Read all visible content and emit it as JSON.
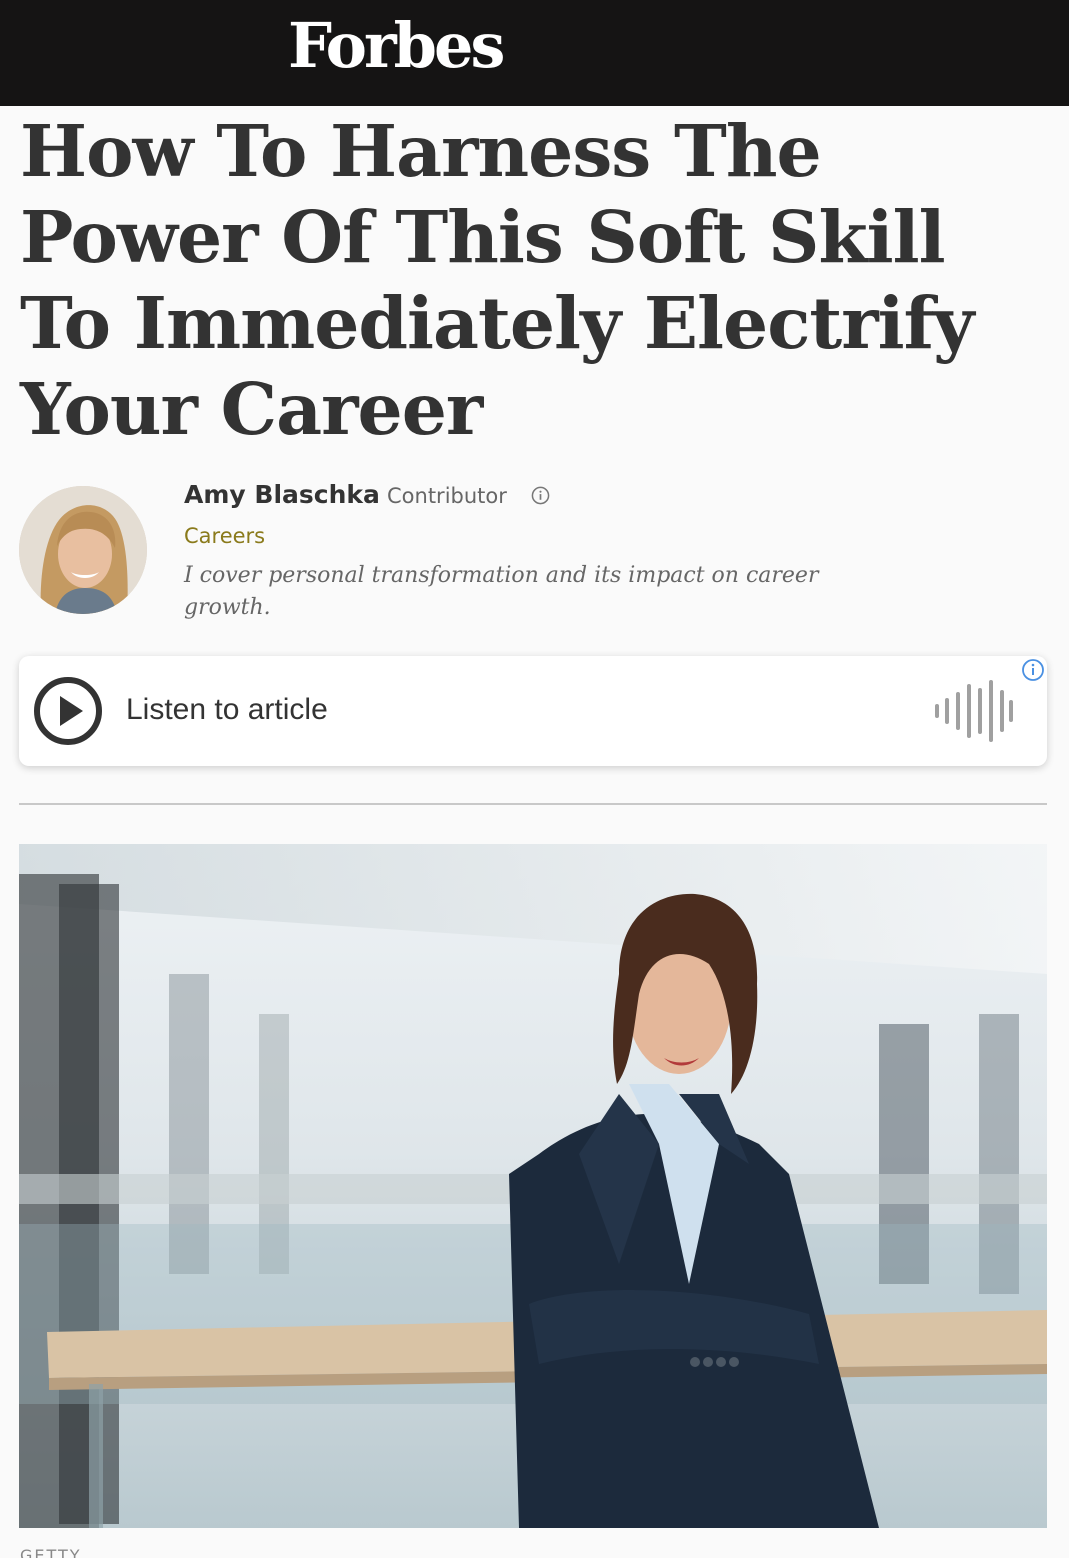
{
  "header": {
    "logo_text": "Forbes"
  },
  "article": {
    "headline": "How To Harness The Power Of This Soft Skill To Immediately Electrify Your Career"
  },
  "author": {
    "name": "Amy Blaschka",
    "role": "Contributor",
    "section": "Careers",
    "bio": "I cover personal transformation and its impact on career growth."
  },
  "audio": {
    "label": "Listen to article"
  },
  "image": {
    "caption": "GETTY"
  },
  "colors": {
    "topbar": "#151414",
    "section_link": "#8a7a1b",
    "info_accent": "#4a90e2"
  },
  "icons": [
    "info-icon",
    "play-icon",
    "soundwave-icon",
    "info-circle-icon"
  ]
}
